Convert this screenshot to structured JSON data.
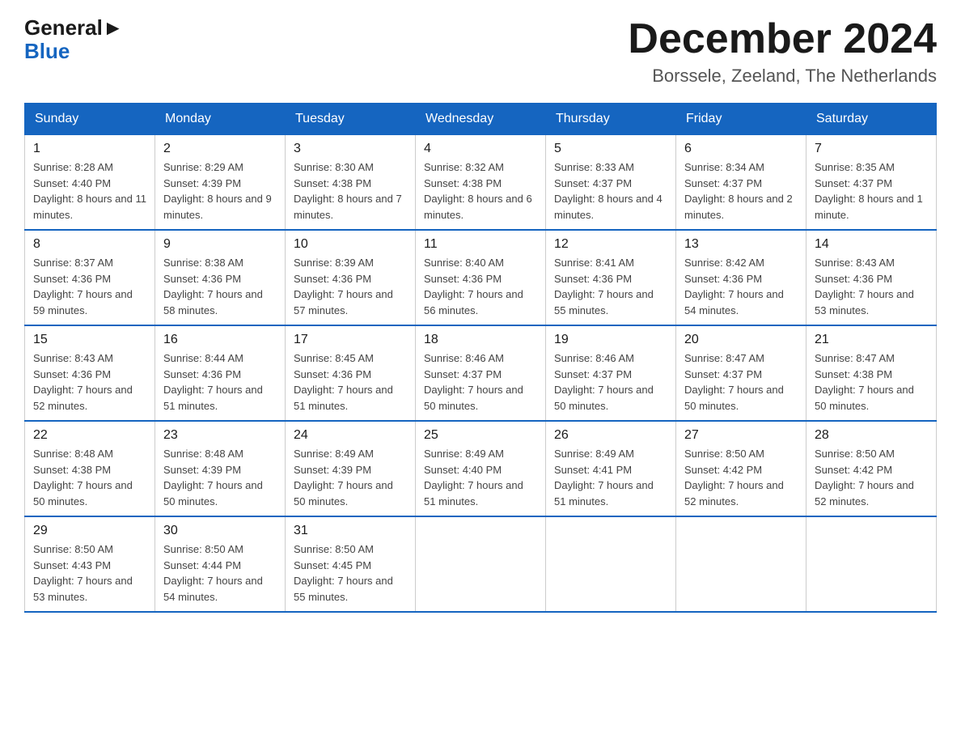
{
  "logo": {
    "general": "General",
    "blue": "Blue"
  },
  "header": {
    "month": "December 2024",
    "location": "Borssele, Zeeland, The Netherlands"
  },
  "weekdays": [
    "Sunday",
    "Monday",
    "Tuesday",
    "Wednesday",
    "Thursday",
    "Friday",
    "Saturday"
  ],
  "weeks": [
    [
      {
        "day": "1",
        "sunrise": "8:28 AM",
        "sunset": "4:40 PM",
        "daylight": "8 hours and 11 minutes."
      },
      {
        "day": "2",
        "sunrise": "8:29 AM",
        "sunset": "4:39 PM",
        "daylight": "8 hours and 9 minutes."
      },
      {
        "day": "3",
        "sunrise": "8:30 AM",
        "sunset": "4:38 PM",
        "daylight": "8 hours and 7 minutes."
      },
      {
        "day": "4",
        "sunrise": "8:32 AM",
        "sunset": "4:38 PM",
        "daylight": "8 hours and 6 minutes."
      },
      {
        "day": "5",
        "sunrise": "8:33 AM",
        "sunset": "4:37 PM",
        "daylight": "8 hours and 4 minutes."
      },
      {
        "day": "6",
        "sunrise": "8:34 AM",
        "sunset": "4:37 PM",
        "daylight": "8 hours and 2 minutes."
      },
      {
        "day": "7",
        "sunrise": "8:35 AM",
        "sunset": "4:37 PM",
        "daylight": "8 hours and 1 minute."
      }
    ],
    [
      {
        "day": "8",
        "sunrise": "8:37 AM",
        "sunset": "4:36 PM",
        "daylight": "7 hours and 59 minutes."
      },
      {
        "day": "9",
        "sunrise": "8:38 AM",
        "sunset": "4:36 PM",
        "daylight": "7 hours and 58 minutes."
      },
      {
        "day": "10",
        "sunrise": "8:39 AM",
        "sunset": "4:36 PM",
        "daylight": "7 hours and 57 minutes."
      },
      {
        "day": "11",
        "sunrise": "8:40 AM",
        "sunset": "4:36 PM",
        "daylight": "7 hours and 56 minutes."
      },
      {
        "day": "12",
        "sunrise": "8:41 AM",
        "sunset": "4:36 PM",
        "daylight": "7 hours and 55 minutes."
      },
      {
        "day": "13",
        "sunrise": "8:42 AM",
        "sunset": "4:36 PM",
        "daylight": "7 hours and 54 minutes."
      },
      {
        "day": "14",
        "sunrise": "8:43 AM",
        "sunset": "4:36 PM",
        "daylight": "7 hours and 53 minutes."
      }
    ],
    [
      {
        "day": "15",
        "sunrise": "8:43 AM",
        "sunset": "4:36 PM",
        "daylight": "7 hours and 52 minutes."
      },
      {
        "day": "16",
        "sunrise": "8:44 AM",
        "sunset": "4:36 PM",
        "daylight": "7 hours and 51 minutes."
      },
      {
        "day": "17",
        "sunrise": "8:45 AM",
        "sunset": "4:36 PM",
        "daylight": "7 hours and 51 minutes."
      },
      {
        "day": "18",
        "sunrise": "8:46 AM",
        "sunset": "4:37 PM",
        "daylight": "7 hours and 50 minutes."
      },
      {
        "day": "19",
        "sunrise": "8:46 AM",
        "sunset": "4:37 PM",
        "daylight": "7 hours and 50 minutes."
      },
      {
        "day": "20",
        "sunrise": "8:47 AM",
        "sunset": "4:37 PM",
        "daylight": "7 hours and 50 minutes."
      },
      {
        "day": "21",
        "sunrise": "8:47 AM",
        "sunset": "4:38 PM",
        "daylight": "7 hours and 50 minutes."
      }
    ],
    [
      {
        "day": "22",
        "sunrise": "8:48 AM",
        "sunset": "4:38 PM",
        "daylight": "7 hours and 50 minutes."
      },
      {
        "day": "23",
        "sunrise": "8:48 AM",
        "sunset": "4:39 PM",
        "daylight": "7 hours and 50 minutes."
      },
      {
        "day": "24",
        "sunrise": "8:49 AM",
        "sunset": "4:39 PM",
        "daylight": "7 hours and 50 minutes."
      },
      {
        "day": "25",
        "sunrise": "8:49 AM",
        "sunset": "4:40 PM",
        "daylight": "7 hours and 51 minutes."
      },
      {
        "day": "26",
        "sunrise": "8:49 AM",
        "sunset": "4:41 PM",
        "daylight": "7 hours and 51 minutes."
      },
      {
        "day": "27",
        "sunrise": "8:50 AM",
        "sunset": "4:42 PM",
        "daylight": "7 hours and 52 minutes."
      },
      {
        "day": "28",
        "sunrise": "8:50 AM",
        "sunset": "4:42 PM",
        "daylight": "7 hours and 52 minutes."
      }
    ],
    [
      {
        "day": "29",
        "sunrise": "8:50 AM",
        "sunset": "4:43 PM",
        "daylight": "7 hours and 53 minutes."
      },
      {
        "day": "30",
        "sunrise": "8:50 AM",
        "sunset": "4:44 PM",
        "daylight": "7 hours and 54 minutes."
      },
      {
        "day": "31",
        "sunrise": "8:50 AM",
        "sunset": "4:45 PM",
        "daylight": "7 hours and 55 minutes."
      },
      null,
      null,
      null,
      null
    ]
  ]
}
